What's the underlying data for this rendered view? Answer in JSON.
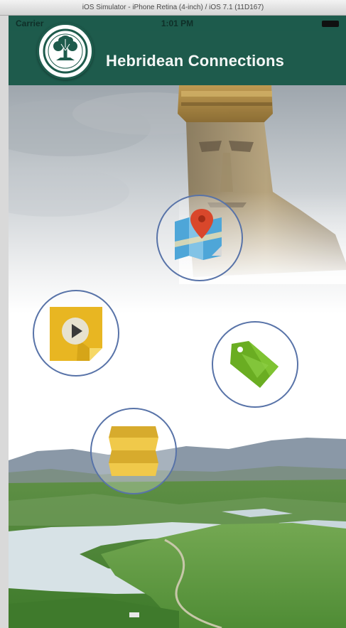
{
  "simulator": {
    "title": "iOS Simulator - iPhone Retina (4-inch) / iOS 7.1 (11D167)"
  },
  "status_bar": {
    "carrier": "Carrier",
    "time": "1:01 PM"
  },
  "nav": {
    "title": "Hebridean Connections"
  },
  "menu": [
    {
      "name": "map-button",
      "icon": "map-pin-icon"
    },
    {
      "name": "media-button",
      "icon": "play-icon"
    },
    {
      "name": "tag-button",
      "icon": "tag-icon"
    },
    {
      "name": "folded-map-button",
      "icon": "folded-map-icon"
    }
  ],
  "colors": {
    "nav_green": "#1e5b4c",
    "ring_blue": "#5873a8",
    "pin_red": "#d9472b",
    "play_yellow": "#e8b622",
    "tag_green": "#6aad22"
  }
}
